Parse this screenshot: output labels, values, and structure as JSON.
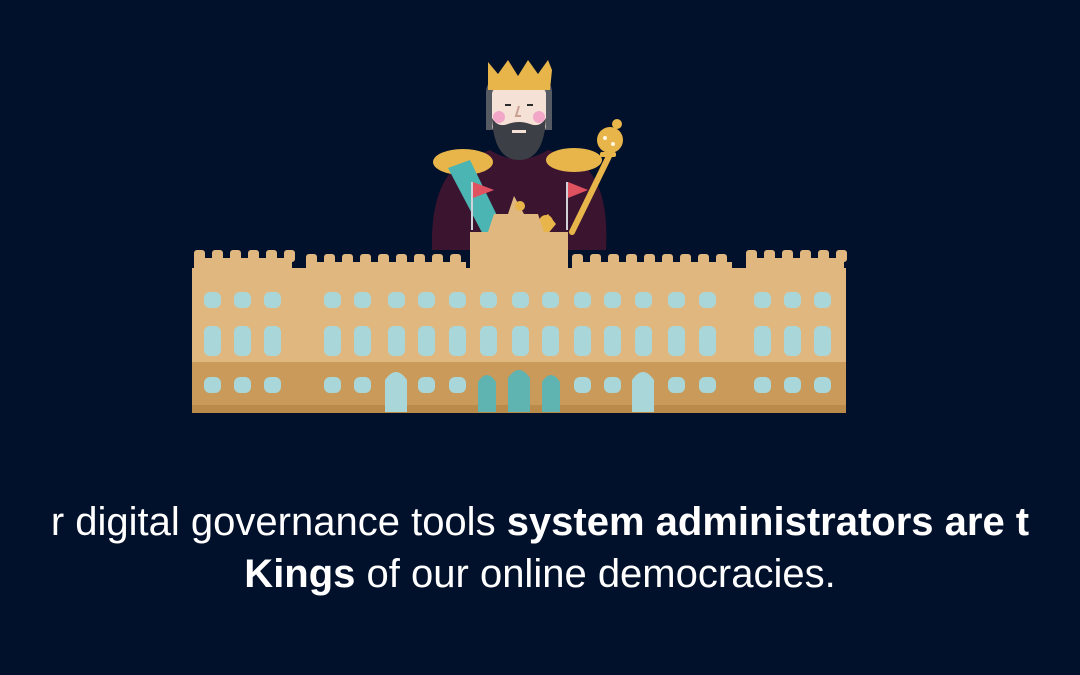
{
  "colors": {
    "background": "#01102b",
    "palace": "#dfb77f",
    "palace_base": "#c99a5a",
    "window": "#a9d6d8",
    "door": "#5fb3b0",
    "crown": "#e8b54a",
    "robe": "#3b1530",
    "sash": "#4bb5b3",
    "flag": "#e05260",
    "text": "#ffffff"
  },
  "icons": {
    "king": "king-illustration",
    "palace": "palace-illustration",
    "scepter": "scepter-icon",
    "crown": "crown-icon"
  },
  "caption": {
    "line1": {
      "regular": "r digital governance tools ",
      "bold": "system administrators are t"
    },
    "line2": {
      "bold": "Kings",
      "regular": " of our online democracies."
    }
  }
}
